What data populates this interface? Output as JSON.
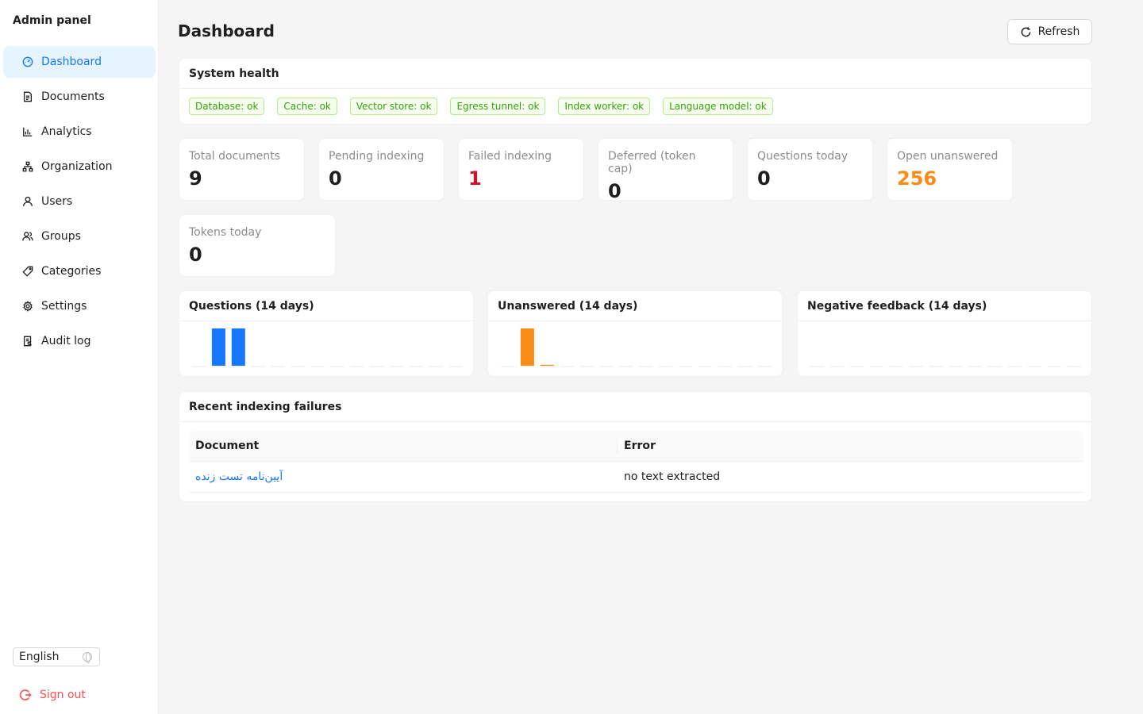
{
  "sidebar": {
    "brand": "Admin panel",
    "items": [
      {
        "label": "Dashboard"
      },
      {
        "label": "Documents"
      },
      {
        "label": "Analytics"
      },
      {
        "label": "Organization"
      },
      {
        "label": "Users"
      },
      {
        "label": "Groups"
      },
      {
        "label": "Categories"
      },
      {
        "label": "Settings"
      },
      {
        "label": "Audit log"
      }
    ],
    "language": "English",
    "signout": "Sign out"
  },
  "header": {
    "title": "Dashboard",
    "refresh_label": "Refresh"
  },
  "health": {
    "title": "System health",
    "tags": [
      "Database: ok",
      "Cache: ok",
      "Vector store: ok",
      "Egress tunnel: ok",
      "Index worker: ok",
      "Language model: ok"
    ]
  },
  "stats": [
    {
      "label": "Total documents",
      "value": "9"
    },
    {
      "label": "Pending indexing",
      "value": "0"
    },
    {
      "label": "Failed indexing",
      "value": "1"
    },
    {
      "label": "Deferred (token cap)",
      "value": "0"
    },
    {
      "label": "Questions today",
      "value": "0"
    },
    {
      "label": "Open unanswered",
      "value": "256"
    },
    {
      "label": "Tokens today",
      "value": "0"
    }
  ],
  "charts": [
    {
      "title": "Questions (14 days)",
      "color": "#1677ff",
      "values": [
        0,
        4,
        4,
        0,
        0,
        0,
        0,
        0,
        0,
        0,
        0,
        0,
        0,
        0
      ]
    },
    {
      "title": "Unanswered (14 days)",
      "color": "#fa8c16",
      "values": [
        0,
        4,
        0.1,
        0,
        0,
        0,
        0,
        0,
        0,
        0,
        0,
        0,
        0,
        0
      ]
    },
    {
      "title": "Negative feedback (14 days)",
      "color": "#1677ff",
      "values": [
        0,
        0,
        0,
        0,
        0,
        0,
        0,
        0,
        0,
        0,
        0,
        0,
        0,
        0
      ]
    }
  ],
  "failures": {
    "title": "Recent indexing failures",
    "columns": [
      "Document",
      "Error"
    ],
    "rows": [
      {
        "document": "آیین‌نامه تست زنده",
        "error": "no text extracted"
      }
    ]
  }
}
